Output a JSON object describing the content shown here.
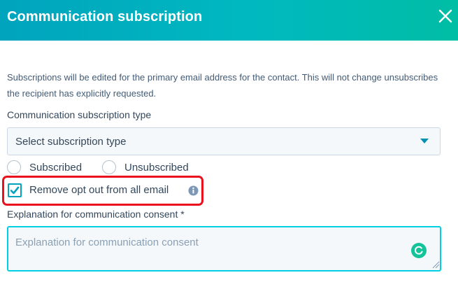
{
  "header": {
    "title": "Communication subscription",
    "close_icon": "close-icon"
  },
  "description": "Subscriptions will be edited for the primary email address for the contact. This will not change unsubscribes the recipient has explicitly requested.",
  "subscription_type": {
    "label": "Communication subscription type",
    "placeholder": "Select subscription type"
  },
  "radios": [
    {
      "label": "Subscribed",
      "checked": false
    },
    {
      "label": "Unsubscribed",
      "checked": false
    }
  ],
  "opt_out": {
    "label": "Remove opt out from all email",
    "checked": true
  },
  "consent": {
    "label": "Explanation for communication consent *",
    "placeholder": "Explanation for communication consent"
  },
  "colors": {
    "header_gradient_start": "#00a4bd",
    "header_gradient_end": "#00bda5",
    "accent": "#00a4bd",
    "highlight": "#e8111d",
    "text": "#33475b"
  }
}
